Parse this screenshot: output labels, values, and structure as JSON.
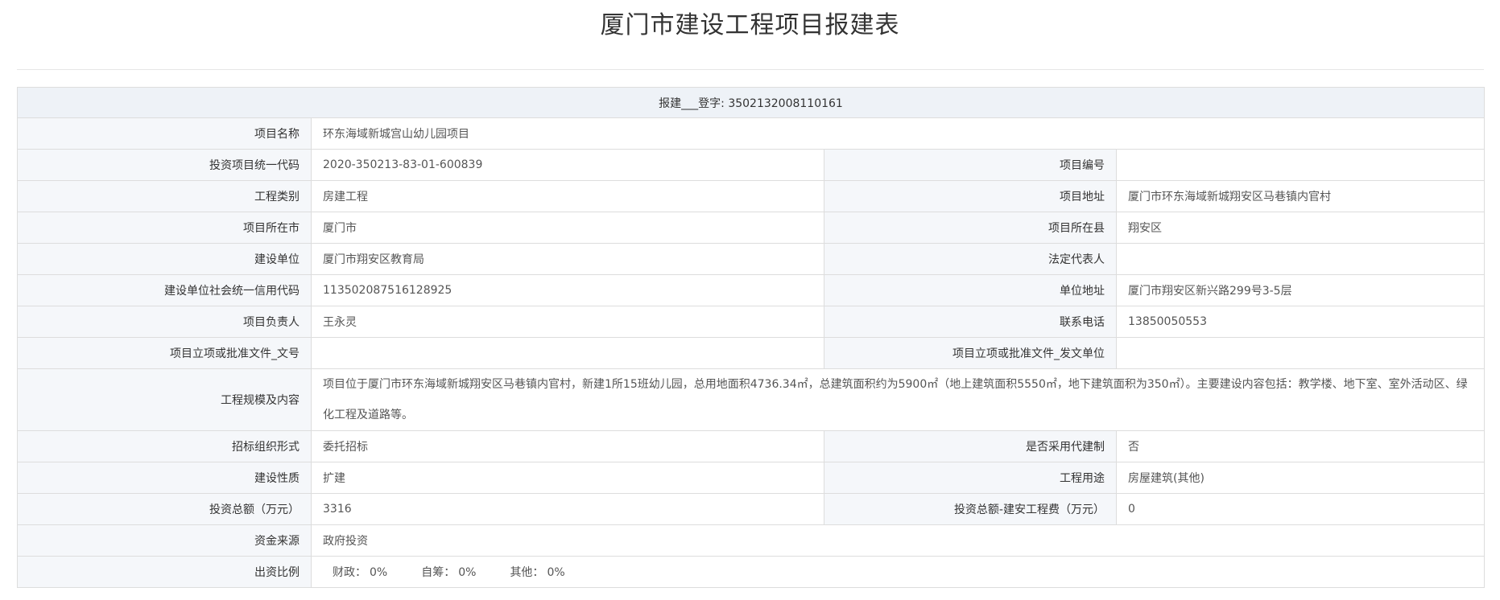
{
  "page": {
    "title": "厦门市建设工程项目报建表"
  },
  "header": {
    "text": "报建___登字: 3502132008110161"
  },
  "rows": {
    "project_name": {
      "label": "项目名称",
      "value": "环东海域新城宫山幼儿园项目"
    },
    "invest_code": {
      "label": "投资项目统一代码",
      "value": "2020-350213-83-01-600839"
    },
    "project_no": {
      "label": "项目编号",
      "value": ""
    },
    "category": {
      "label": "工程类别",
      "value": "房建工程"
    },
    "address": {
      "label": "项目地址",
      "value": "厦门市环东海域新城翔安区马巷镇内官村"
    },
    "city": {
      "label": "项目所在市",
      "value": "厦门市"
    },
    "county": {
      "label": "项目所在县",
      "value": "翔安区"
    },
    "builder": {
      "label": "建设单位",
      "value": "厦门市翔安区教育局"
    },
    "legal_rep": {
      "label": "法定代表人",
      "value": ""
    },
    "credit_code": {
      "label": "建设单位社会统一信用代码",
      "value": "113502087516128925"
    },
    "unit_address": {
      "label": "单位地址",
      "value": "厦门市翔安区新兴路299号3-5层"
    },
    "manager": {
      "label": "项目负责人",
      "value": "王永灵"
    },
    "phone": {
      "label": "联系电话",
      "value": "13850050553"
    },
    "approval_no": {
      "label": "项目立项或批准文件_文号",
      "value": ""
    },
    "approval_unit": {
      "label": "项目立项或批准文件_发文单位",
      "value": ""
    },
    "scale": {
      "label": "工程规模及内容",
      "value": "项目位于厦门市环东海域新城翔安区马巷镇内官村，新建1所15班幼儿园，总用地面积4736.34㎡，总建筑面积约为5900㎡（地上建筑面积5550㎡，地下建筑面积为350㎡）。主要建设内容包括：教学楼、地下室、室外活动区、绿化工程及道路等。"
    },
    "bidding": {
      "label": "招标组织形式",
      "value": "委托招标"
    },
    "agency": {
      "label": "是否采用代建制",
      "value": "否"
    },
    "nature": {
      "label": "建设性质",
      "value": "扩建"
    },
    "usage": {
      "label": "工程用途",
      "value": "房屋建筑(其他)"
    },
    "total_invest": {
      "label": "投资总额（万元）",
      "value": "3316"
    },
    "install_invest": {
      "label": "投资总额-建安工程费（万元）",
      "value": "0"
    },
    "fund_source": {
      "label": "资金来源",
      "value": "政府投资"
    },
    "ratio": {
      "label": "出资比例",
      "fiscal_label": "财政：",
      "fiscal_value": "0%",
      "self_label": "自筹：",
      "self_value": "0%",
      "other_label": "其他：",
      "other_value": "0%"
    }
  }
}
